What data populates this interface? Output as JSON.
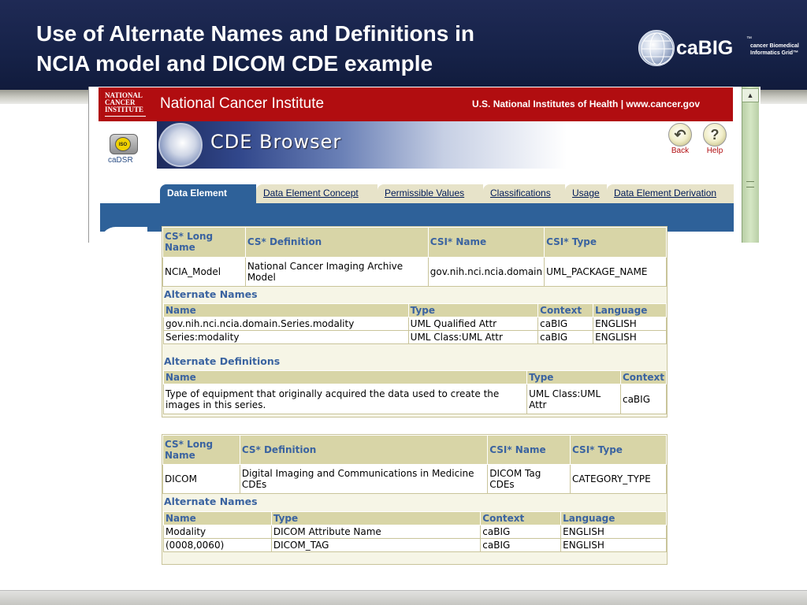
{
  "slide": {
    "title": "Use of Alternate Names and Definitions in\nNCIA model and DICOM CDE example",
    "logo": {
      "word": "caBIG",
      "tm": "™",
      "subtitle": "cancer Biomedical Informatics Grid™"
    }
  },
  "browser": {
    "nci_name": "National Cancer Institute",
    "nci_logo": "NATIONAL CANCER INSTITUTE",
    "nih_links": "U.S. National Institutes of Health | www.cancer.gov",
    "cadsr_label": "caDSR",
    "iso_badge": "ISO",
    "app_title": "CDE Browser",
    "back_label": "Back",
    "help_label": "Help",
    "tabs": [
      {
        "label": "Data Element"
      },
      {
        "label": "Data Element Concept"
      },
      {
        "label": "Permissible Values"
      },
      {
        "label": "Classifications"
      },
      {
        "label": "Usage"
      },
      {
        "label": "Data Element Derivation"
      }
    ],
    "scroll_up": "▲"
  },
  "table1": {
    "headers": [
      "CS* Long Name",
      "CS* Definition",
      "CSI* Name",
      "CSI* Type"
    ],
    "row": [
      "NCIA_Model",
      "National Cancer Imaging Archive Model",
      "gov.nih.nci.ncia.domain",
      "UML_PACKAGE_NAME"
    ],
    "alt_names_title": "Alternate Names",
    "alt_names_headers": [
      "Name",
      "Type",
      "Context",
      "Language"
    ],
    "alt_names_rows": [
      [
        "gov.nih.nci.ncia.domain.Series.modality",
        "UML Qualified Attr",
        "caBIG",
        "ENGLISH"
      ],
      [
        "Series:modality",
        "UML Class:UML Attr",
        "caBIG",
        "ENGLISH"
      ]
    ],
    "alt_defs_title": "Alternate Definitions",
    "alt_defs_headers": [
      "Name",
      "Type",
      "Context"
    ],
    "alt_defs_rows": [
      [
        "Type of equipment that originally acquired the data used to create the images in this series.",
        "UML Class:UML Attr",
        "caBIG"
      ]
    ]
  },
  "table2": {
    "headers": [
      "CS* Long Name",
      "CS* Definition",
      "CSI* Name",
      "CSI* Type"
    ],
    "row": [
      "DICOM",
      "Digital Imaging and Communications in Medicine CDEs",
      "DICOM Tag CDEs",
      "CATEGORY_TYPE"
    ],
    "alt_names_title": "Alternate Names",
    "alt_names_headers": [
      "Name",
      "Type",
      "Context",
      "Language"
    ],
    "alt_names_rows": [
      [
        "Modality",
        "DICOM Attribute Name",
        "caBIG",
        "ENGLISH"
      ],
      [
        "(0008,0060)",
        "DICOM_TAG",
        "caBIG",
        "ENGLISH"
      ]
    ]
  }
}
